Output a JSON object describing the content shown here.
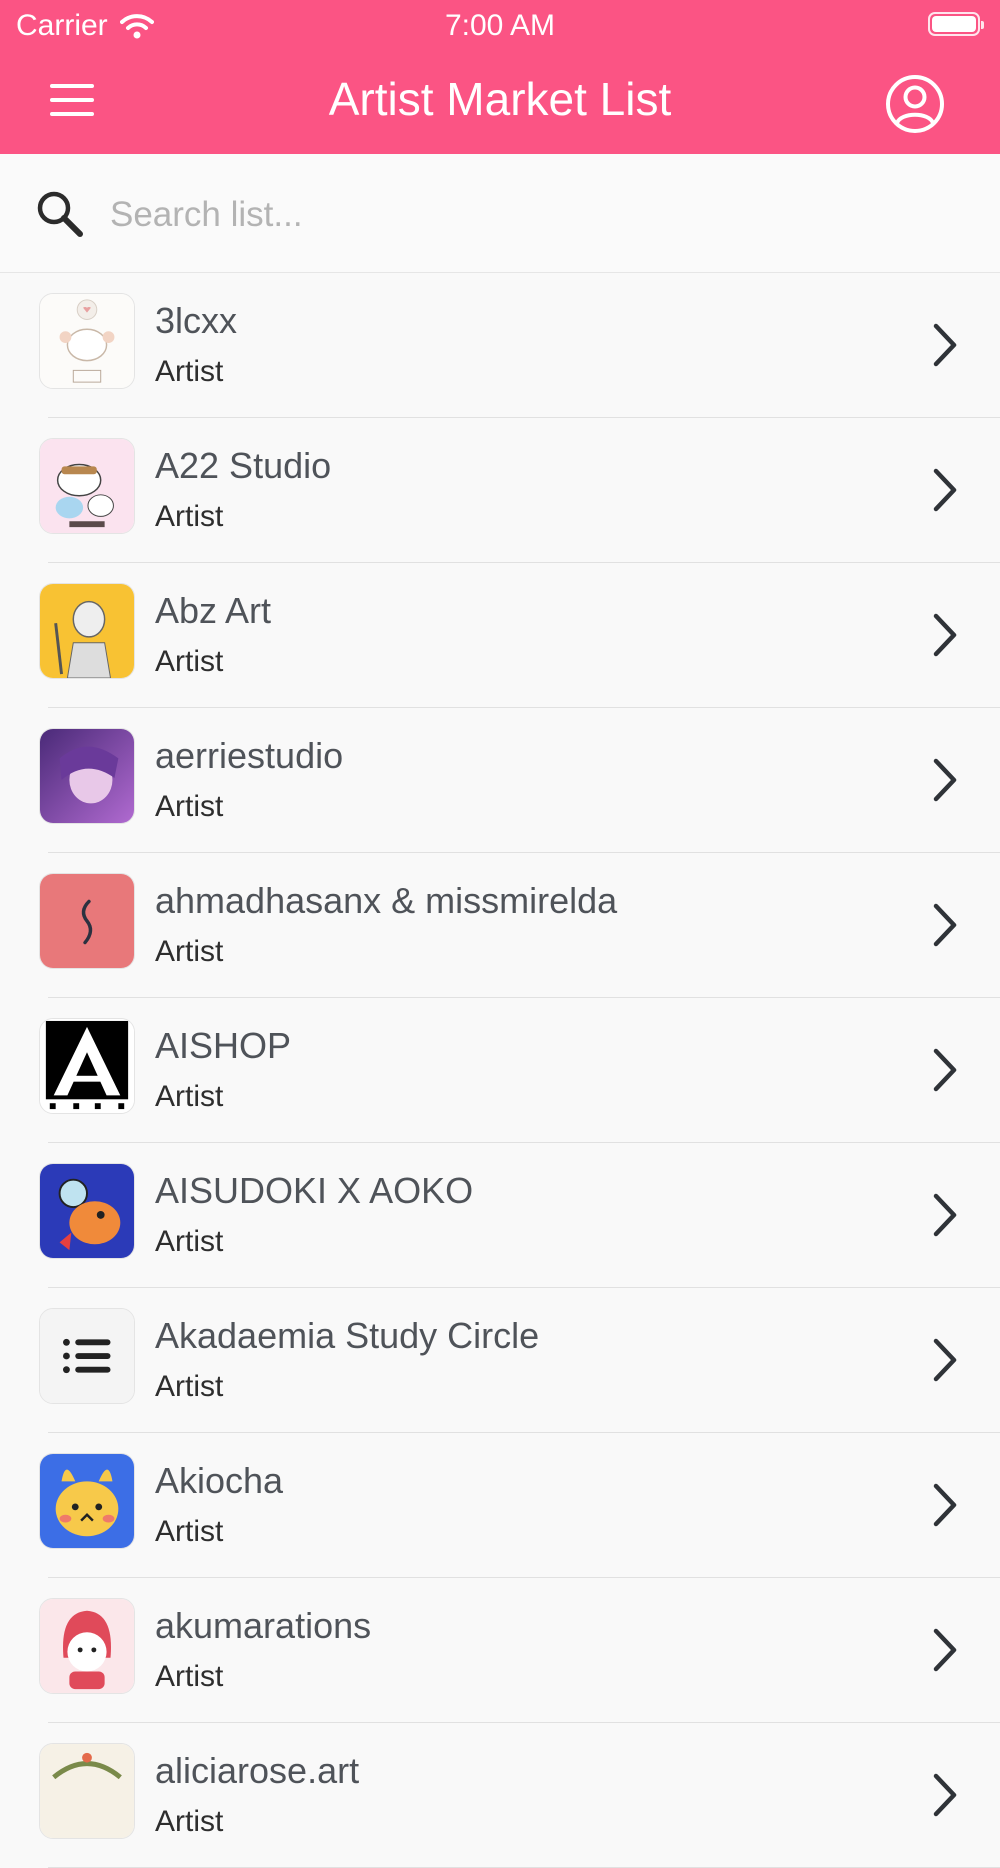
{
  "status_bar": {
    "carrier": "Carrier",
    "time": "7:00 AM"
  },
  "header": {
    "title": "Artist Market List",
    "menu_icon": "hamburger-menu-icon",
    "profile_icon": "user-circle-icon",
    "background_color": "#fb5484"
  },
  "search": {
    "placeholder": "Search list...",
    "value": "",
    "icon": "search-icon"
  },
  "list": {
    "items": [
      {
        "name": "3lcxx",
        "subtitle": "Artist"
      },
      {
        "name": "A22 Studio",
        "subtitle": "Artist"
      },
      {
        "name": "Abz Art",
        "subtitle": "Artist"
      },
      {
        "name": "aerriestudio",
        "subtitle": "Artist"
      },
      {
        "name": "ahmadhasanx & missmirelda",
        "subtitle": "Artist"
      },
      {
        "name": "AISHOP",
        "subtitle": "Artist"
      },
      {
        "name": "AISUDOKI X AOKO",
        "subtitle": "Artist"
      },
      {
        "name": "Akadaemia Study Circle",
        "subtitle": "Artist"
      },
      {
        "name": "Akiocha",
        "subtitle": "Artist"
      },
      {
        "name": "akumarations",
        "subtitle": "Artist"
      },
      {
        "name": "aliciarose.art",
        "subtitle": "Artist"
      }
    ],
    "row_icon": "chevron-right-icon"
  }
}
